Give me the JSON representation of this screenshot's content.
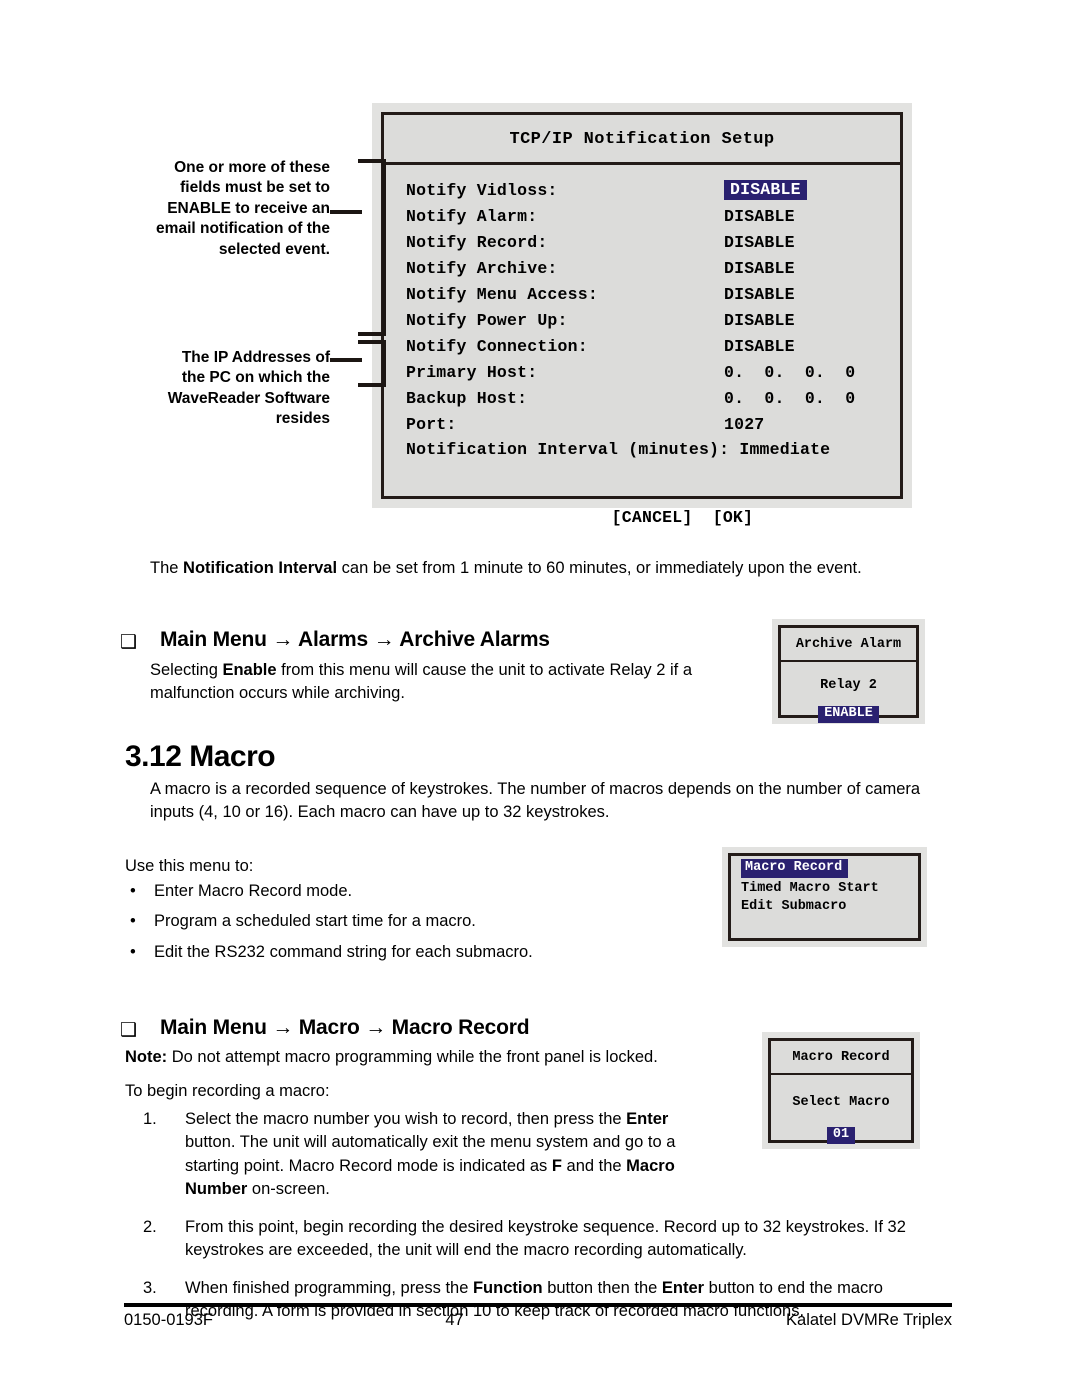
{
  "tcpip_dialog": {
    "title": "TCP/IP Notification Setup",
    "rows": [
      {
        "label": "Notify Vidloss:",
        "value": "DISABLE",
        "highlighted": true
      },
      {
        "label": "Notify Alarm:",
        "value": "DISABLE",
        "highlighted": false
      },
      {
        "label": "Notify Record:",
        "value": "DISABLE",
        "highlighted": false
      },
      {
        "label": "Notify Archive:",
        "value": "DISABLE",
        "highlighted": false
      },
      {
        "label": "Notify Menu Access:",
        "value": "DISABLE",
        "highlighted": false
      },
      {
        "label": "Notify Power Up:",
        "value": "DISABLE",
        "highlighted": false
      },
      {
        "label": "Notify Connection:",
        "value": "DISABLE",
        "highlighted": false
      },
      {
        "label": "Primary Host:",
        "value": "0.  0.  0.  0",
        "highlighted": false
      },
      {
        "label": "Backup Host:",
        "value": "0.  0.  0.  0",
        "highlighted": false
      },
      {
        "label": "Port:",
        "value": "1027",
        "highlighted": false
      }
    ],
    "interval_row": "Notification Interval (minutes): Immediate",
    "buttons": "[CANCEL]  [OK]",
    "cancel_label": "[CANCEL]",
    "ok_label": "[OK]",
    "highlight_color": "#2a2170"
  },
  "callouts": {
    "enable_note": "One or more of these fields must be set to ENABLE to receive an email notification of the selected event.",
    "ip_note": "The IP Addresses of the PC on which the WaveReader Software resides"
  },
  "body": {
    "interval_paragraph_pre": "The ",
    "interval_paragraph_bold": "Notification Interval",
    "interval_paragraph_post": " can be set from 1 minute to 60 minutes, or immediately upon the event.",
    "head_archive_alarms": "Main Menu → Alarms → Archive Alarms",
    "head_macro_record": "Main Menu → Macro → Macro Record",
    "checkbox_glyph": "❑",
    "archive_pre": "Selecting ",
    "archive_bold": "Enable",
    "archive_post": " from this menu will cause the unit to activate Relay 2 if a malfunction occurs while archiving.",
    "section_number_title": "3.12 Macro",
    "macro_desc": "A macro is a recorded sequence of keystrokes.  The number of macros depends on the number of camera inputs (4, 10 or 16).  Each macro can have up to 32 keystrokes.",
    "use_menu_intro": "Use this menu to:",
    "bullet_glyph": "•",
    "bullets": [
      "Enter Macro Record mode.",
      "Program a scheduled start time for a macro.",
      "Edit the RS232 command string for each submacro."
    ],
    "note_bold": "Note:",
    "note_text": "  Do not attempt macro programming while the front panel is locked.",
    "begin_text": "To begin recording a macro:",
    "step1_num": "1.",
    "step1_a": "Select the macro number you wish to record, then press the ",
    "step1_b_bold": "Enter",
    "step1_c": " button.  The unit will automatically exit the menu system and go to a starting point.  Macro Record mode is indicated as ",
    "step1_d_bold": "F",
    "step1_e": " and the ",
    "step1_f_bold": "Macro Number",
    "step1_g": " on-screen.",
    "step2_num": "2.",
    "step2_text": "From this point, begin recording the desired keystroke sequence.  Record up to 32 keystrokes.  If 32 keystrokes are exceeded, the unit will end the macro recording automatically.",
    "step3_num": "3.",
    "step3_a": "When finished programming, press the ",
    "step3_b_bold": "Function",
    "step3_c": " button then the ",
    "step3_d_bold": "Enter",
    "step3_e": " button to end the macro recording.  A form is provided in section 10 to keep track of recorded macro functions."
  },
  "archive_alarm_dialog": {
    "title": "Archive Alarm",
    "relay_label": "Relay 2",
    "state_value": "ENABLE"
  },
  "macro_menu_dialog": {
    "items": [
      {
        "label": "Macro Record",
        "highlighted": true
      },
      {
        "label": "Timed Macro Start",
        "highlighted": false
      },
      {
        "label": "Edit Submacro",
        "highlighted": false
      }
    ]
  },
  "select_macro_dialog": {
    "title": "Macro Record",
    "label": "Select Macro",
    "value": "01"
  },
  "footer": {
    "doc_number": "0150-0193F",
    "page_number": "47",
    "product": "Kalatel DVMRe Triplex"
  }
}
